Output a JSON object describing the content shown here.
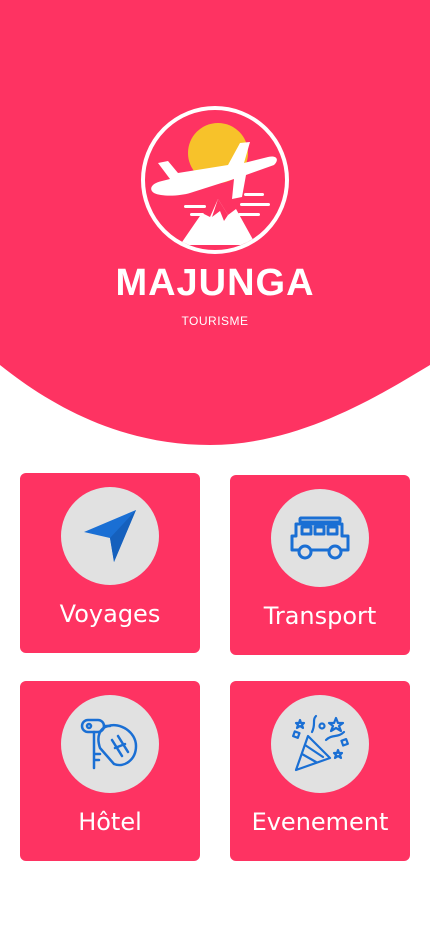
{
  "brand": {
    "name": "MAJUNGA",
    "tagline": "TOURISME"
  },
  "colors": {
    "primary": "#fe3362",
    "icon_bg": "#e1e1e1",
    "icon": "#1a6fd4",
    "sun": "#f7c22a"
  },
  "menu": [
    {
      "label": "Voyages",
      "icon": "paper-plane-icon"
    },
    {
      "label": "Transport",
      "icon": "jeep-icon"
    },
    {
      "label": "Hôtel",
      "icon": "hotel-key-icon"
    },
    {
      "label": "Evenement",
      "icon": "party-popper-icon"
    }
  ]
}
